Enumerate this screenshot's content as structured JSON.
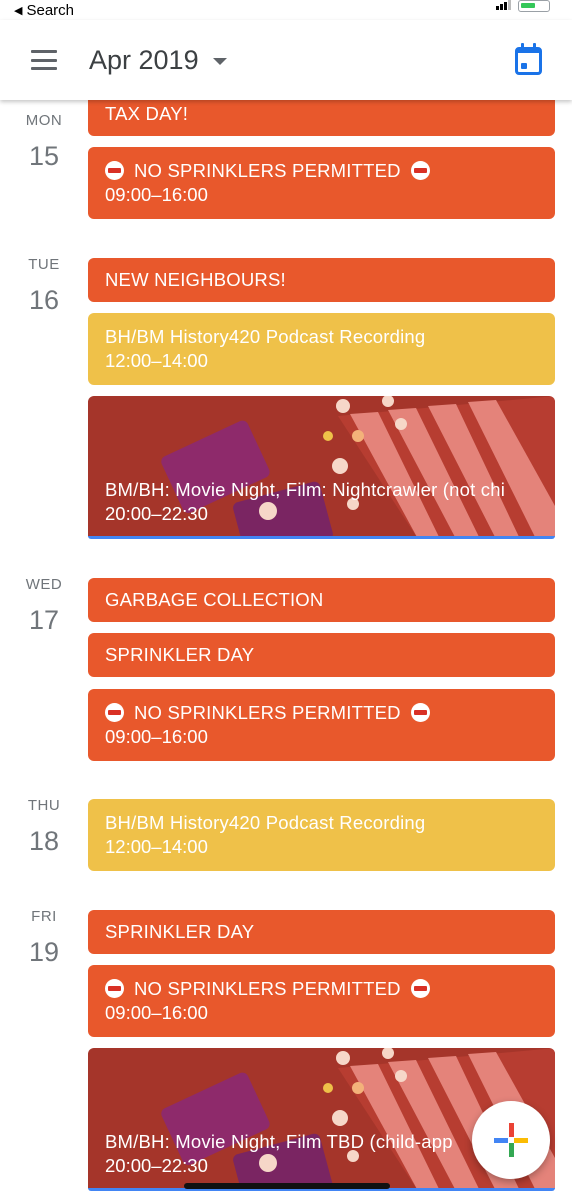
{
  "status_bar": {
    "back_label": "Search"
  },
  "header": {
    "month": "Apr 2019"
  },
  "days": [
    {
      "dow": "MON",
      "date": "15",
      "events": [
        {
          "title": "TAX DAY!",
          "time": ""
        },
        {
          "title": "NO SPRINKLERS PERMITTED",
          "time": "09:00–16:00"
        }
      ]
    },
    {
      "dow": "TUE",
      "date": "16",
      "events": [
        {
          "title": "NEW NEIGHBOURS!",
          "time": ""
        },
        {
          "title": "BH/BM History420 Podcast Recording",
          "time": "12:00–14:00"
        },
        {
          "title": "BM/BH: Movie Night, Film: Nightcrawler (not chi",
          "time": "20:00–22:30"
        }
      ]
    },
    {
      "dow": "WED",
      "date": "17",
      "events": [
        {
          "title": "GARBAGE COLLECTION",
          "time": ""
        },
        {
          "title": "SPRINKLER DAY",
          "time": ""
        },
        {
          "title": "NO SPRINKLERS PERMITTED",
          "time": "09:00–16:00"
        }
      ]
    },
    {
      "dow": "THU",
      "date": "18",
      "events": [
        {
          "title": "BH/BM History420 Podcast Recording",
          "time": "12:00–14:00"
        }
      ]
    },
    {
      "dow": "FRI",
      "date": "19",
      "events": [
        {
          "title": "SPRINKLER DAY",
          "time": ""
        },
        {
          "title": "NO SPRINKLERS PERMITTED",
          "time": "09:00–16:00"
        },
        {
          "title": "BM/BH: Movie Night, Film TBD (child-app",
          "time": "20:00–22:30"
        }
      ]
    }
  ],
  "colors": {
    "tomato": "#e8582c",
    "banana": "#efc149",
    "movie_bg": "#a5352a",
    "accent": "#1a73e8"
  },
  "icons": {
    "menu": "hamburger-menu-icon",
    "today": "calendar-today-icon",
    "no_entry": "no-entry-icon",
    "create": "plus-icon"
  }
}
